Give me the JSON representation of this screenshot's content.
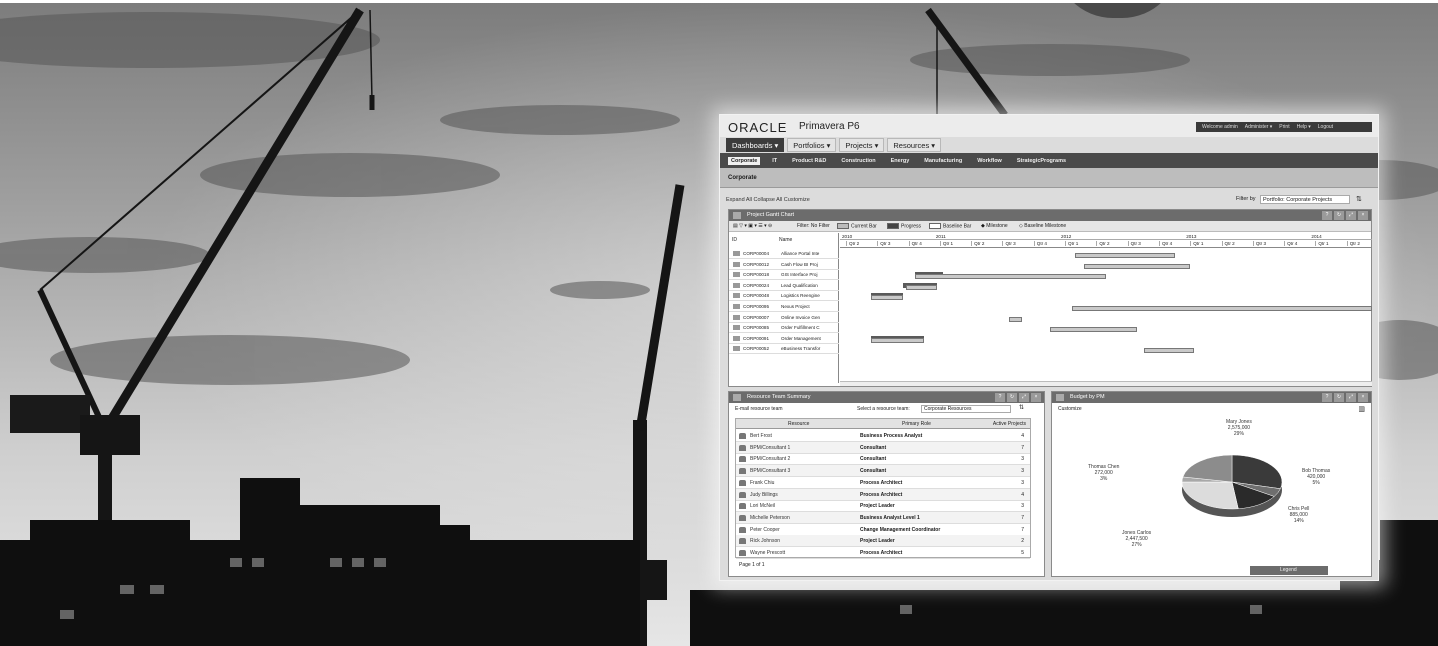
{
  "app": {
    "logo": "ORACLE",
    "product": "Primavera P6",
    "user_bar": [
      "Welcome admin",
      "Administer ▾",
      "Print",
      "Help ▾",
      "Logout"
    ]
  },
  "main_menu": [
    {
      "label": "Dashboards ▾",
      "active": true
    },
    {
      "label": "Portfolios ▾",
      "active": false
    },
    {
      "label": "Projects ▾",
      "active": false
    },
    {
      "label": "Resources ▾",
      "active": false
    }
  ],
  "dashboard_tabs": [
    {
      "label": "Corporate",
      "active": true
    },
    {
      "label": "IT",
      "active": false
    },
    {
      "label": "Product R&D",
      "active": false
    },
    {
      "label": "Construction",
      "active": false
    },
    {
      "label": "Energy",
      "active": false
    },
    {
      "label": "Manufacturing",
      "active": false
    },
    {
      "label": "Workflow",
      "active": false
    },
    {
      "label": "StrategicPrograms",
      "active": false
    }
  ],
  "page": {
    "title": "Corporate",
    "expand_links": "Expand All  Collapse All  Customize",
    "filter_label": "Filter by",
    "filter_value": "Portfolio: Corporate Projects"
  },
  "gantt": {
    "title": "Project Gantt Chart",
    "tools": {
      "filter": "Filter: No Filter",
      "current_bar": "Current Bar",
      "progress": "Progress",
      "baseline_bar": "Baseline Bar",
      "milestone": "Milestone",
      "baseline_milestone": "Baseline Milestone"
    },
    "col_id": "ID",
    "col_name": "Name",
    "years": [
      "2010",
      "2011",
      "2012",
      "2013",
      "2014"
    ],
    "quarters": [
      "Qtr 2",
      "Qtr 3",
      "Qtr 4",
      "Qtr 1",
      "Qtr 2",
      "Qtr 3",
      "Qtr 4",
      "Qtr 1",
      "Qtr 2",
      "Qtr 3",
      "Qtr 4",
      "Qtr 1",
      "Qtr 2",
      "Qtr 3",
      "Qtr 4",
      "Qtr 1",
      "Qtr 2"
    ],
    "rows": [
      {
        "id": "CORP00004",
        "name": "Alliance Portal Inte"
      },
      {
        "id": "CORP00012",
        "name": "Cash Flow BI Proj"
      },
      {
        "id": "CORP00018",
        "name": "GIS Interface Proj"
      },
      {
        "id": "CORP00024",
        "name": "Lead Qualification"
      },
      {
        "id": "CORP00048",
        "name": "Logistics Reengine"
      },
      {
        "id": "CORP00095",
        "name": "Nexus Project"
      },
      {
        "id": "CORP00007",
        "name": "Online Invoice Gen"
      },
      {
        "id": "CORP00085",
        "name": "Order Fulfillment C"
      },
      {
        "id": "CORP00091",
        "name": "Order Management"
      },
      {
        "id": "CORP00052",
        "name": "eBusiness Transfor"
      }
    ]
  },
  "resource": {
    "title": "Resource Team Summary",
    "email_label": "E-mail resource team",
    "select_label": "Select a resource team:",
    "select_value": "Corporate Resources",
    "headers": [
      "Resource",
      "Primary Role",
      "Active Projects"
    ],
    "rows": [
      {
        "name": "Bert Frost",
        "role": "Business Process Analyst",
        "count": "4"
      },
      {
        "name": "BPM/Consultant 1",
        "role": "Consultant",
        "count": "7"
      },
      {
        "name": "BPM/Consultant 2",
        "role": "Consultant",
        "count": "3"
      },
      {
        "name": "BPM/Consultant 3",
        "role": "Consultant",
        "count": "3"
      },
      {
        "name": "Frank Chiu",
        "role": "Process Architect",
        "count": "3"
      },
      {
        "name": "Judy Billings",
        "role": "Process Architect",
        "count": "4"
      },
      {
        "name": "Lori McNeil",
        "role": "Project Leader",
        "count": "3"
      },
      {
        "name": "Michelle Peterson",
        "role": "Business Analyst Level 1",
        "count": "7"
      },
      {
        "name": "Peter Cooper",
        "role": "Change Management Coordinator",
        "count": "7"
      },
      {
        "name": "Rick Johnson",
        "role": "Project Leader",
        "count": "2"
      },
      {
        "name": "Wayne Prescott",
        "role": "Process Architect",
        "count": "5"
      }
    ],
    "pager": "Page 1 of 1"
  },
  "budget": {
    "title": "Budget by PM",
    "subtitle": "Customize",
    "legend_button": "Legend",
    "slices": [
      {
        "label": "Mary Jones",
        "value": "2,575,000",
        "pct": "29%",
        "color": "#3a3a3a"
      },
      {
        "label": "Bob Thomas",
        "value": "420,000",
        "pct": "5%",
        "color": "#6e6e6e"
      },
      {
        "label": "Chris Pell",
        "value": "885,000",
        "pct": "14%",
        "color": "#2a2a2a"
      },
      {
        "label": "Jones Carlos",
        "value": "2,447,500",
        "pct": "27%",
        "color": "#dcdcdc"
      },
      {
        "label": "Thomas Chen",
        "value": "272,000",
        "pct": "3%",
        "color": "#a8a8a8"
      }
    ]
  },
  "colors": {
    "sky_light": "#d6d6d6",
    "sky_dark": "#6a6a6a",
    "silhouette": "#111111"
  }
}
